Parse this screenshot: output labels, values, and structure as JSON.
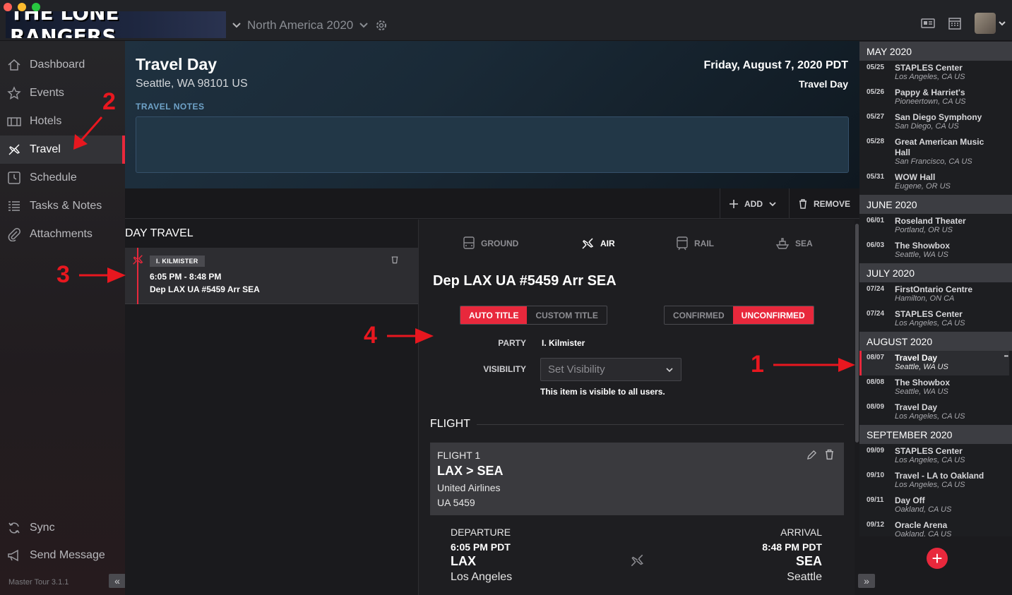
{
  "app": {
    "logo": "THE LONE RANGERS",
    "tour": "North America 2020",
    "version": "Master Tour 3.1.1"
  },
  "colors": {
    "accent": "#e8283c",
    "sidebar": "#262629",
    "header": "#1f3140",
    "month_band": "#3c3d42"
  },
  "nav": {
    "items": [
      {
        "label": "Dashboard",
        "icon": "home-icon"
      },
      {
        "label": "Events",
        "icon": "star-icon"
      },
      {
        "label": "Hotels",
        "icon": "bed-icon"
      },
      {
        "label": "Travel",
        "icon": "plane-icon",
        "active": true
      },
      {
        "label": "Schedule",
        "icon": "clock-icon"
      },
      {
        "label": "Tasks & Notes",
        "icon": "list-icon"
      },
      {
        "label": "Attachments",
        "icon": "paperclip-icon"
      }
    ],
    "sync": "Sync",
    "send_message": "Send Message"
  },
  "header": {
    "title": "Travel Day",
    "location": "Seattle, WA 98101 US",
    "date": "Friday, August 7, 2020 PDT",
    "day_type": "Travel Day",
    "notes_label": "TRAVEL NOTES"
  },
  "actions": {
    "add": "ADD",
    "remove": "REMOVE"
  },
  "day_travel": {
    "title": "DAY TRAVEL",
    "item": {
      "tag": "I. KILMISTER",
      "time": "6:05 PM - 8:48 PM",
      "name": "Dep LAX UA #5459 Arr SEA"
    }
  },
  "detail": {
    "tabs": [
      "GROUND",
      "AIR",
      "RAIL",
      "SEA"
    ],
    "active_tab": "AIR",
    "title": "Dep LAX UA #5459 Arr SEA",
    "title_toggle": [
      "AUTO TITLE",
      "CUSTOM TITLE"
    ],
    "status_toggle": [
      "CONFIRMED",
      "UNCONFIRMED"
    ],
    "party_label": "PARTY",
    "party_value": "I. Kilmister",
    "visibility_label": "VISIBILITY",
    "visibility_placeholder": "Set Visibility",
    "visibility_note": "This item is visible to all users.",
    "flight_section": "FLIGHT",
    "flight": {
      "label": "FLIGHT 1",
      "route": "LAX > SEA",
      "airline": "United Airlines",
      "number": "UA 5459"
    },
    "departure": {
      "label": "DEPARTURE",
      "time": "6:05 PM PDT",
      "code": "LAX",
      "city": "Los Angeles"
    },
    "arrival": {
      "label": "ARRIVAL",
      "time": "8:48 PM PDT",
      "code": "SEA",
      "city": "Seattle"
    }
  },
  "schedule": [
    {
      "month": "MAY 2020",
      "entries": [
        {
          "date": "05/25",
          "name": "STAPLES Center",
          "city": "Los Angeles, CA US"
        },
        {
          "date": "05/26",
          "name": "Pappy & Harriet's",
          "city": "Pioneertown, CA US"
        },
        {
          "date": "05/27",
          "name": "San Diego Symphony",
          "city": "San Diego, CA US"
        },
        {
          "date": "05/28",
          "name": "Great American Music Hall",
          "city": "San Francisco, CA US"
        },
        {
          "date": "05/31",
          "name": "WOW Hall",
          "city": "Eugene, OR US"
        }
      ]
    },
    {
      "month": "JUNE 2020",
      "entries": [
        {
          "date": "06/01",
          "name": "Roseland Theater",
          "city": "Portland, OR US"
        },
        {
          "date": "06/03",
          "name": "The Showbox",
          "city": "Seattle, WA US"
        }
      ]
    },
    {
      "month": "JULY 2020",
      "entries": [
        {
          "date": "07/24",
          "name": "FirstOntario Centre",
          "city": "Hamilton, ON CA"
        },
        {
          "date": "07/24",
          "name": "STAPLES Center",
          "city": "Los Angeles, CA US"
        }
      ]
    },
    {
      "month": "AUGUST 2020",
      "entries": [
        {
          "date": "08/07",
          "name": "Travel Day",
          "city": "Seattle, WA US",
          "active": true
        },
        {
          "date": "08/08",
          "name": "The Showbox",
          "city": "Seattle, WA US"
        },
        {
          "date": "08/09",
          "name": "Travel Day",
          "city": "Los Angeles, CA US"
        }
      ]
    },
    {
      "month": "SEPTEMBER 2020",
      "entries": [
        {
          "date": "09/09",
          "name": "STAPLES Center",
          "city": "Los Angeles, CA US"
        },
        {
          "date": "09/10",
          "name": "Travel - LA to Oakland",
          "city": "Los Angeles, CA US"
        },
        {
          "date": "09/11",
          "name": "Day Off",
          "city": "Oakland, CA US"
        },
        {
          "date": "09/12",
          "name": "Oracle Arena",
          "city": "Oakland, CA US"
        }
      ]
    }
  ],
  "annotations": [
    "1",
    "2",
    "3",
    "4"
  ]
}
